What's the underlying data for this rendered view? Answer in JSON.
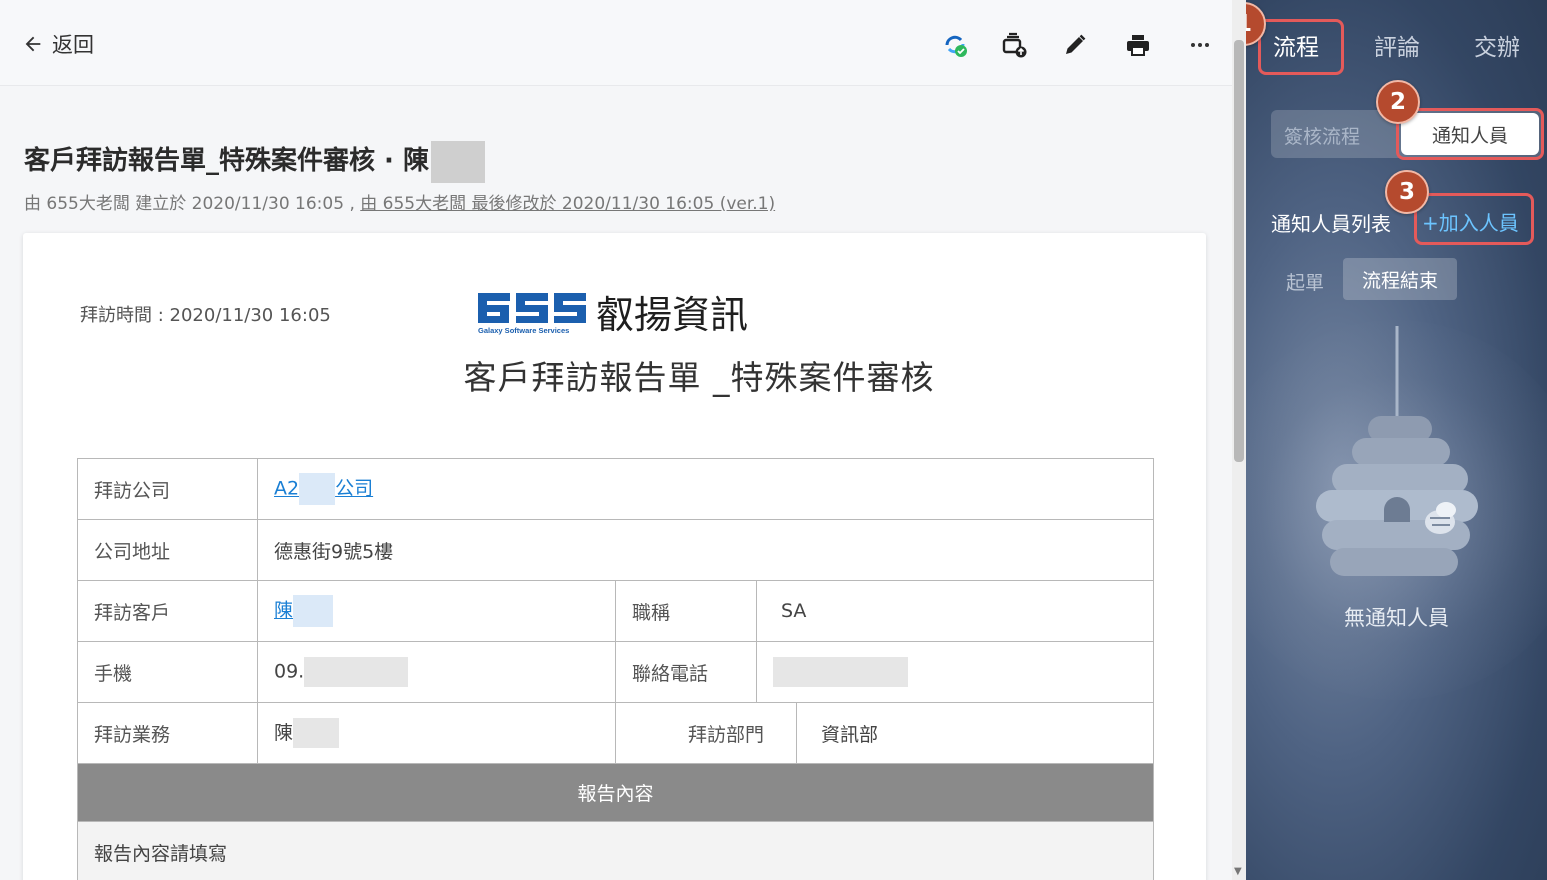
{
  "topbar": {
    "back_label": "返回",
    "tools": [
      "sync-check-icon",
      "layers-upload-icon",
      "pencil-icon",
      "printer-icon",
      "more-icon"
    ]
  },
  "document": {
    "title": "客戶拜訪報告單_特殊案件審核 · 陳",
    "meta_prefix": "由 655大老闆 建立於 2020/11/30 16:05 , ",
    "meta_link": "由 655大老闆 最後修改於 2020/11/30 16:05  (ver.1)"
  },
  "form": {
    "visit_time": "拜訪時間 : 2020/11/30 16:05",
    "logo_text": "叡揚資訊",
    "logo_sub": "Galaxy Software Services",
    "heading": "客戶拜訪報告單 _特殊案件審核",
    "rows": {
      "company_label": "拜訪公司",
      "company_value_a": "A2",
      "company_value_b": "公司",
      "address_label": "公司地址",
      "address_value": "德惠街9號5樓",
      "customer_label": "拜訪客戶",
      "customer_value": "陳",
      "title_label": "職稱",
      "title_value": "SA",
      "mobile_label": "手機",
      "mobile_value": "09.",
      "phone_label": "聯絡電話",
      "sales_label": "拜訪業務",
      "sales_value": "陳",
      "dept_label": "拜訪部門",
      "dept_value": "資訊部",
      "section_label": "報告內容",
      "report_placeholder": "報告內容請填寫"
    }
  },
  "panel": {
    "tabs": [
      "流程",
      "評論",
      "交辦"
    ],
    "segment": {
      "left": "簽核流程",
      "right": "通知人員"
    },
    "list_label": "通知人員列表",
    "add_label": "+加入人員",
    "chips": {
      "start": "起單",
      "end": "流程結束"
    },
    "empty_text": "無通知人員",
    "badges": [
      "1",
      "2",
      "3"
    ]
  },
  "colors": {
    "accent_link": "#1a7fd4",
    "highlight": "#e45a5a",
    "badge": "#b54a2e",
    "add_button": "#6cc4ff"
  }
}
